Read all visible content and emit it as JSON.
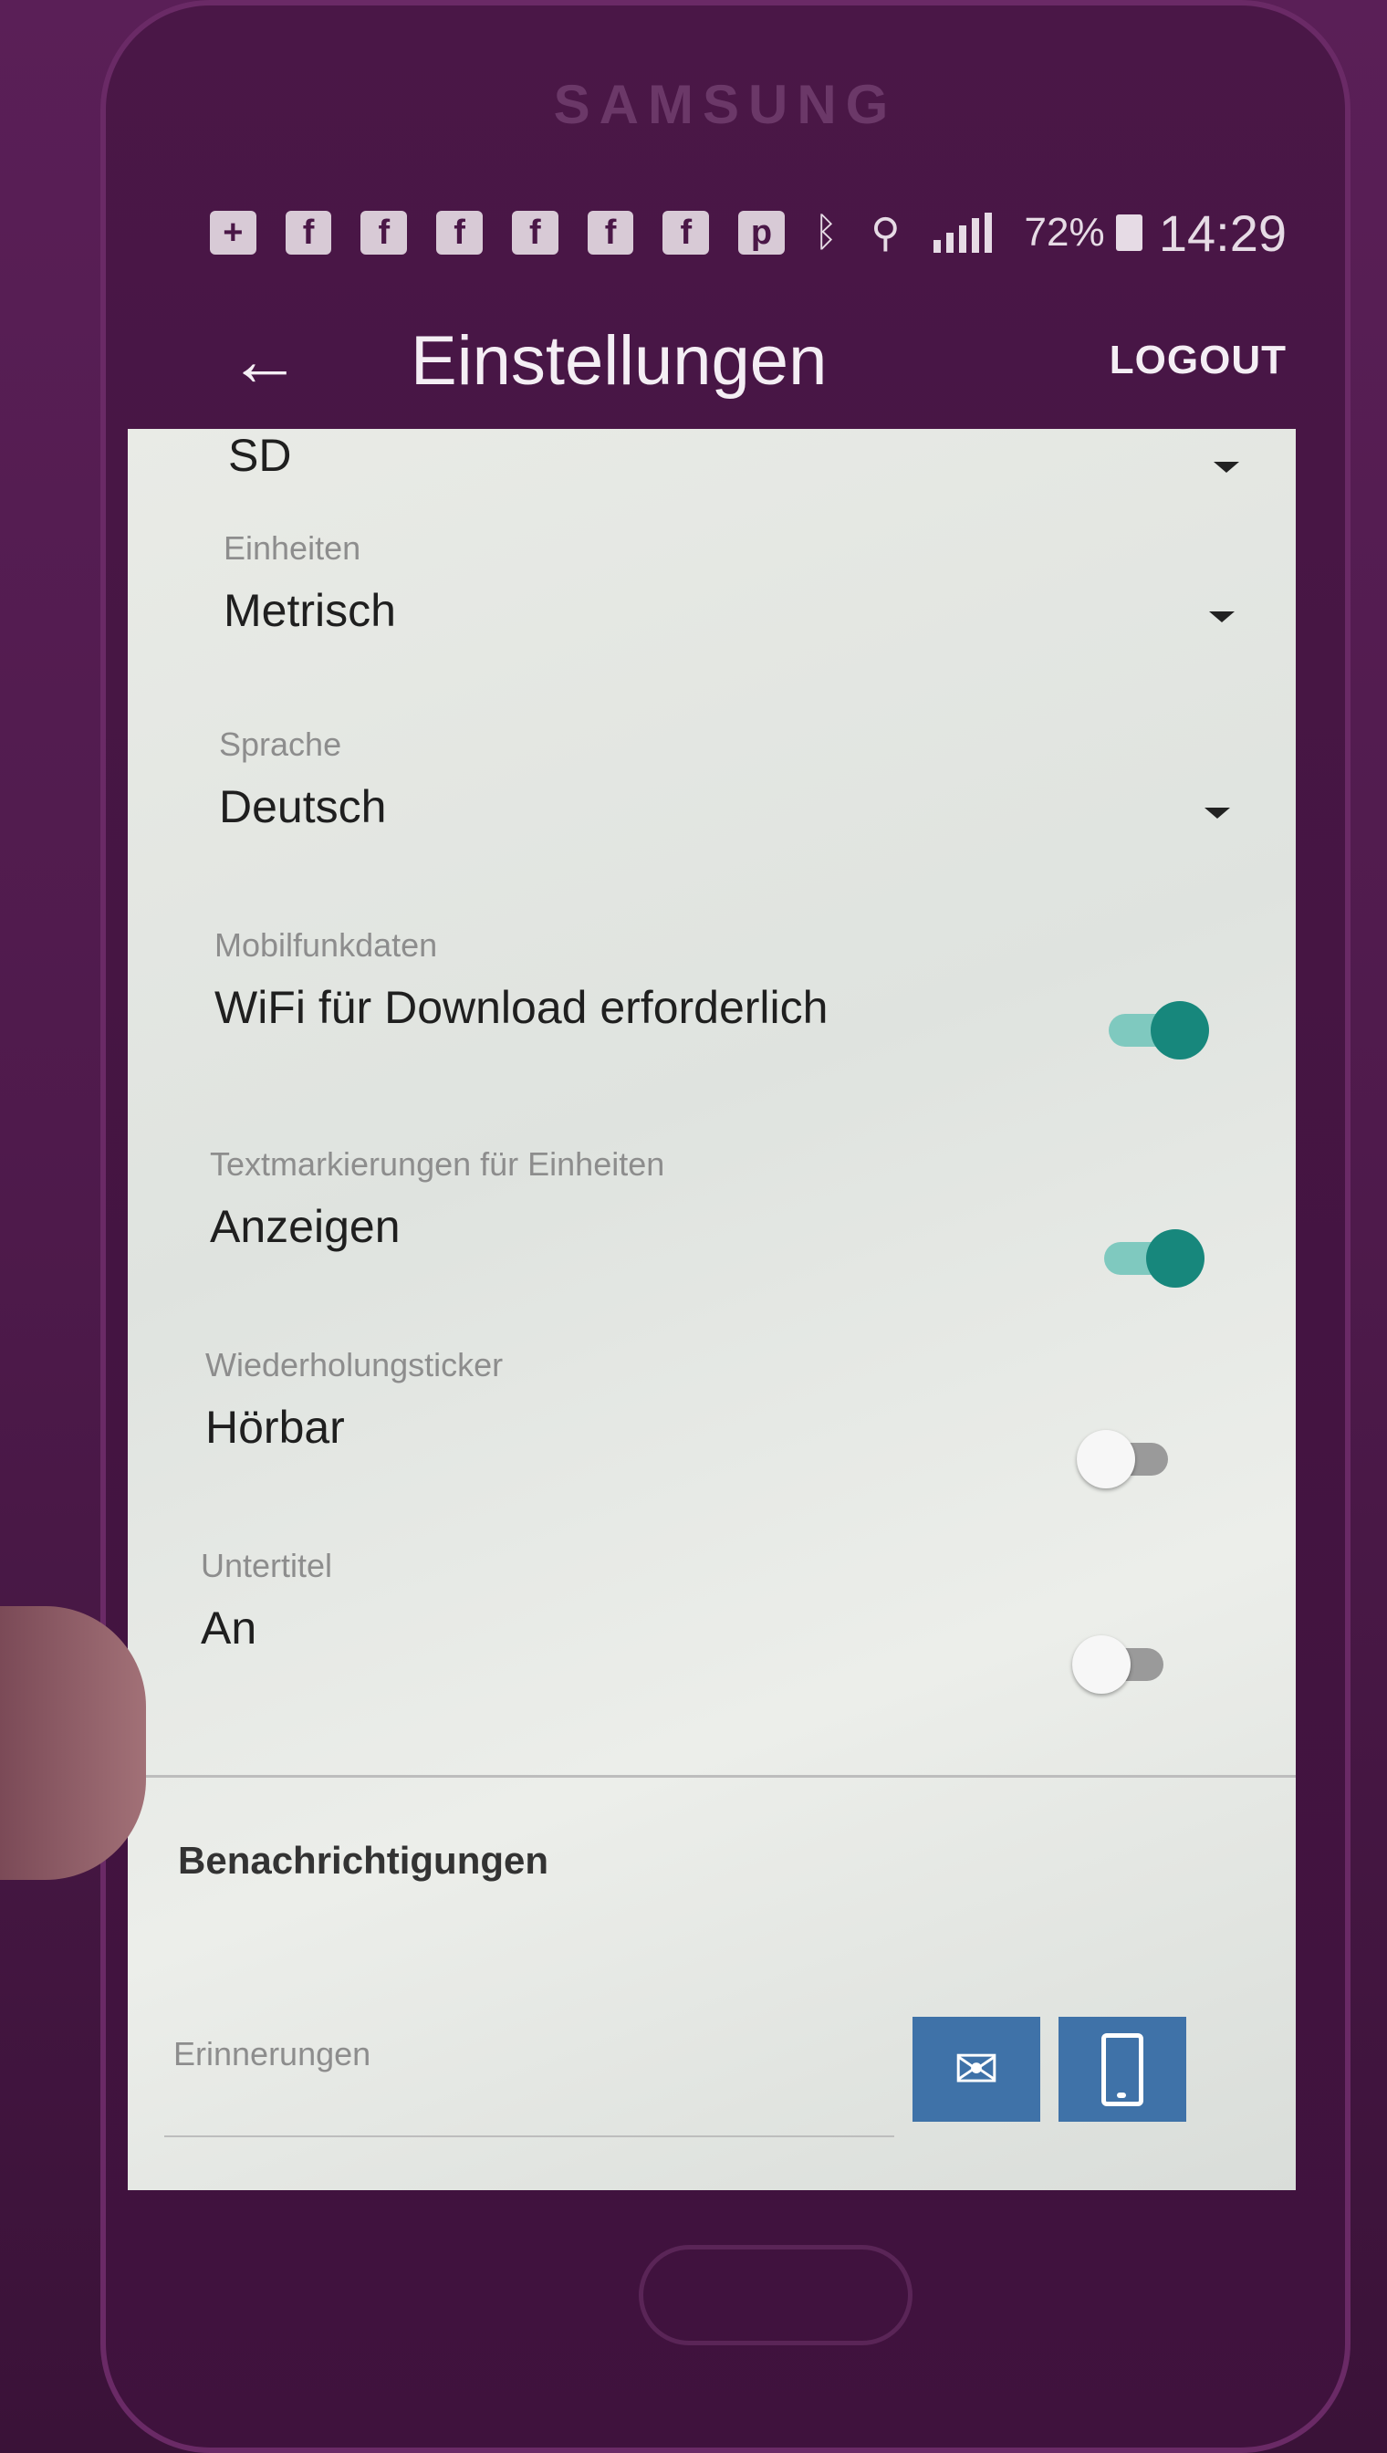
{
  "device": {
    "brand": "SAMSUNG"
  },
  "status_bar": {
    "notification_icons": [
      "add-icon",
      "facebook-icon",
      "facebook-icon",
      "facebook-icon",
      "facebook-icon",
      "facebook-icon",
      "facebook-icon",
      "pinterest-icon"
    ],
    "battery": "72%",
    "time": "14:29"
  },
  "app_bar": {
    "title": "Einstellungen",
    "logout": "LOGOUT"
  },
  "settings": {
    "quality_value": "SD",
    "units": {
      "caption": "Einheiten",
      "value": "Metrisch"
    },
    "language": {
      "caption": "Sprache",
      "value": "Deutsch"
    },
    "mobile_data": {
      "caption": "Mobilfunkdaten",
      "label": "WiFi für Download erforderlich",
      "on": true
    },
    "unit_markers": {
      "caption": "Textmarkierungen für Einheiten",
      "label": "Anzeigen",
      "on": true
    },
    "repeat_ticker": {
      "caption": "Wiederholungsticker",
      "label": "Hörbar",
      "on": false
    },
    "subtitles": {
      "caption": "Untertitel",
      "label": "An",
      "on": false
    }
  },
  "notifications": {
    "section_title": "Benachrichtigungen",
    "reminders_caption": "Erinnerungen",
    "email_icon": "mail-icon",
    "device_icon": "smartphone-icon"
  },
  "colors": {
    "toggle_on": "#17877c",
    "button_blue": "#3f72a8"
  }
}
